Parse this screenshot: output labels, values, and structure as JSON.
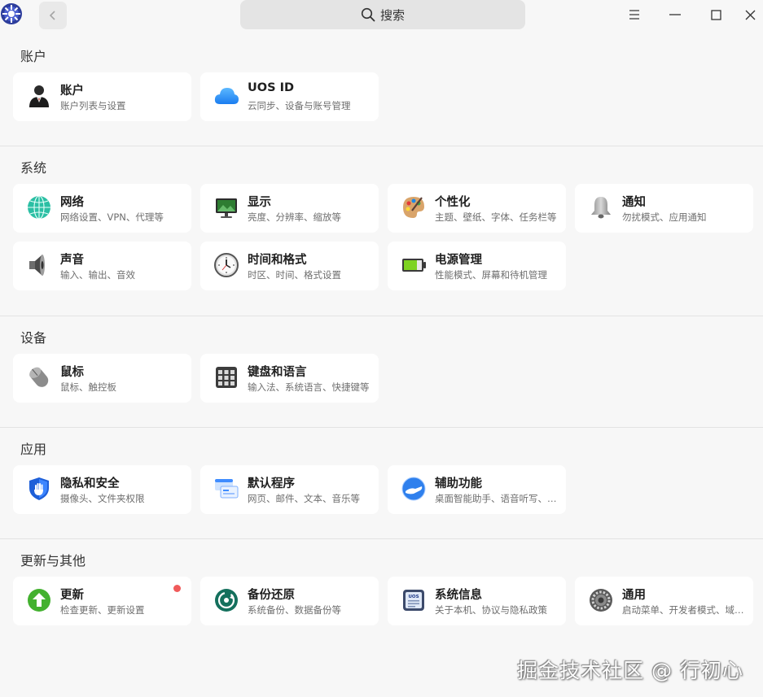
{
  "titlebar": {
    "search_placeholder": "搜索",
    "back_label": "‹"
  },
  "sections": {
    "accounts": {
      "title": "账户",
      "items": [
        {
          "title": "账户",
          "sub": "账户列表与设置",
          "icon": "user-icon"
        },
        {
          "title": "UOS ID",
          "sub": "云同步、设备与账号管理",
          "icon": "cloud-icon"
        }
      ]
    },
    "system": {
      "title": "系统",
      "items": [
        {
          "title": "网络",
          "sub": "网络设置、VPN、代理等",
          "icon": "network-globe-icon"
        },
        {
          "title": "显示",
          "sub": "亮度、分辨率、缩放等",
          "icon": "monitor-icon"
        },
        {
          "title": "个性化",
          "sub": "主题、壁纸、字体、任务栏等",
          "icon": "palette-icon"
        },
        {
          "title": "通知",
          "sub": "勿扰模式、应用通知",
          "icon": "bell-icon"
        },
        {
          "title": "声音",
          "sub": "输入、输出、音效",
          "icon": "speaker-icon"
        },
        {
          "title": "时间和格式",
          "sub": "时区、时间、格式设置",
          "icon": "clock-icon"
        },
        {
          "title": "电源管理",
          "sub": "性能模式、屏幕和待机管理",
          "icon": "battery-icon"
        }
      ]
    },
    "devices": {
      "title": "设备",
      "items": [
        {
          "title": "鼠标",
          "sub": "鼠标、触控板",
          "icon": "mouse-icon"
        },
        {
          "title": "键盘和语言",
          "sub": "输入法、系统语言、快捷键等",
          "icon": "keyboard-icon"
        }
      ]
    },
    "apps": {
      "title": "应用",
      "items": [
        {
          "title": "隐私和安全",
          "sub": "摄像头、文件夹权限",
          "icon": "shield-hand-icon"
        },
        {
          "title": "默认程序",
          "sub": "网页、邮件、文本、音乐等",
          "icon": "default-apps-icon"
        },
        {
          "title": "辅助功能",
          "sub": "桌面智能助手、语音听写、语音朗读",
          "icon": "accessibility-hand-icon"
        }
      ]
    },
    "updates": {
      "title": "更新与其他",
      "items": [
        {
          "title": "更新",
          "sub": "检查更新、更新设置",
          "icon": "update-arrow-icon"
        },
        {
          "title": "备份还原",
          "sub": "系统备份、数据备份等",
          "icon": "backup-icon"
        },
        {
          "title": "系统信息",
          "sub": "关于本机、协议与隐私政策",
          "icon": "system-info-icon"
        },
        {
          "title": "通用",
          "sub": "启动菜单、开发者模式、域管理",
          "icon": "gear-icon"
        }
      ]
    }
  },
  "watermark": "掘金技术社区 @ 行初心",
  "colors": {
    "background": "#f7f7f7",
    "card": "#ffffff",
    "badge": "#f05a5a",
    "search": "#e4e4e4"
  }
}
